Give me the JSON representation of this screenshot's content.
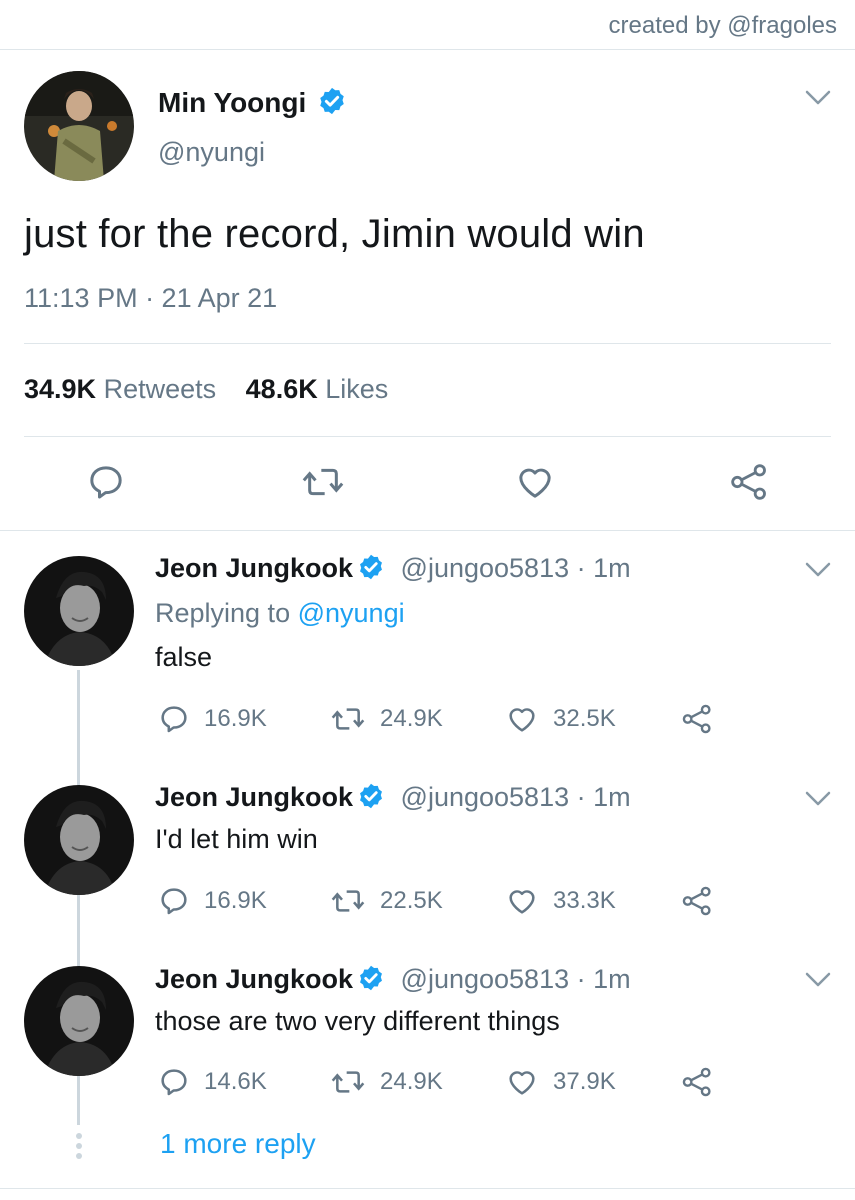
{
  "credit": "created by @fragoles",
  "colors": {
    "accent": "#1da1f2",
    "muted": "#657786",
    "divider": "#dfe6ea",
    "thread_line": "#ccd6dd"
  },
  "main_tweet": {
    "author_name": "Min Yoongi",
    "author_handle": "@nyungi",
    "verified": true,
    "text": "just for the record, Jimin would win",
    "timestamp": "11:13 PM · 21 Apr 21",
    "retweets_count": "34.9K",
    "retweets_label": "Retweets",
    "likes_count": "48.6K",
    "likes_label": "Likes",
    "actions": [
      "reply-icon",
      "retweet-icon",
      "like-icon",
      "share-icon"
    ]
  },
  "replies": [
    {
      "author_name": "Jeon Jungkook",
      "author_handle": "@jungoo5813",
      "time": "· 1m",
      "replying_prefix": "Replying to",
      "replying_to": "@nyungi",
      "text": "false",
      "reply_count": "16.9K",
      "retweet_count": "24.9K",
      "like_count": "32.5K"
    },
    {
      "author_name": "Jeon Jungkook",
      "author_handle": "@jungoo5813",
      "time": "· 1m",
      "text": "I'd let him win",
      "reply_count": "16.9K",
      "retweet_count": "22.5K",
      "like_count": "33.3K"
    },
    {
      "author_name": "Jeon Jungkook",
      "author_handle": "@jungoo5813",
      "time": "· 1m",
      "text": "those are two very different things",
      "reply_count": "14.6K",
      "retweet_count": "24.9K",
      "like_count": "37.9K"
    }
  ],
  "more_replies": "1 more reply"
}
